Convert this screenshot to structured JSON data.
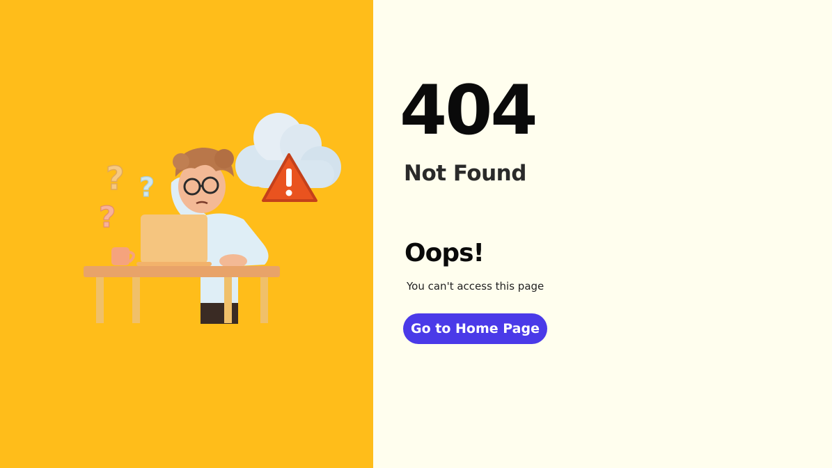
{
  "error": {
    "code": "404",
    "title": "Not Found",
    "headline": "Oops!",
    "message": "You can't  access this page"
  },
  "actions": {
    "home_button_label": "Go to Home Page"
  },
  "illustration": {
    "description_icon": "confused-person-at-laptop-icon",
    "cloud_icon": "cloud-warning-icon",
    "question_marks_icon": "question-marks-icon"
  },
  "colors": {
    "left_background": "#ffbd1a",
    "right_background": "#fffeee",
    "button_background": "#4a3ae8",
    "button_text": "#ffffff",
    "heading_text": "#0a0a0a"
  }
}
